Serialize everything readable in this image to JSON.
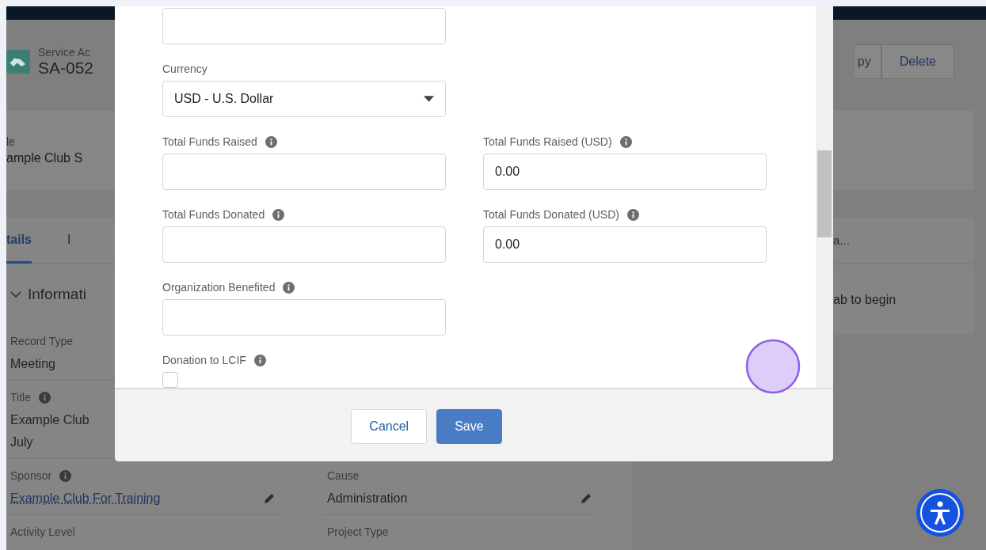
{
  "record": {
    "object_type": "Service Ac",
    "record_name": "SA-052"
  },
  "actions": [
    {
      "label": "py"
    },
    {
      "label": "Delete"
    }
  ],
  "highlight": {
    "label": "le",
    "value": "ample Club S"
  },
  "tabs": [
    {
      "label": "tails",
      "selected": true
    },
    {
      "label": "I",
      "selected": false
    }
  ],
  "section": {
    "title": "Informati",
    "expanded": true
  },
  "details": [
    [
      {
        "label": "Record Type",
        "info": false,
        "kind": "text",
        "lines": [
          "Meeting"
        ],
        "editable": false
      }
    ],
    [
      {
        "label": "Title",
        "info": true,
        "kind": "text",
        "lines": [
          "Example Club",
          "July"
        ],
        "editable": false
      }
    ],
    [
      {
        "label": "Sponsor",
        "info": true,
        "kind": "link",
        "lines": [
          "Example Club For Training"
        ],
        "editable": true
      },
      {
        "label": "Cause",
        "info": false,
        "kind": "text",
        "lines": [
          "Administration"
        ],
        "editable": true
      }
    ],
    [
      {
        "label": "Activity Level",
        "info": false
      },
      {
        "label": "Project Type",
        "info": false
      }
    ]
  ],
  "side_panel": {
    "heading": "a...",
    "message": "ab to begin"
  },
  "modal": {
    "rows": [
      [
        {
          "kind": "text"
        }
      ],
      [
        {
          "kind": "select",
          "label": "Currency",
          "info": false,
          "value": "USD - U.S. Dollar"
        }
      ],
      [
        {
          "kind": "text",
          "label": "Total Funds Raised",
          "info": true
        },
        {
          "kind": "text",
          "label": "Total Funds Raised (USD)",
          "info": true,
          "value": "0.00"
        }
      ],
      [
        {
          "kind": "text",
          "label": "Total Funds Donated",
          "info": true
        },
        {
          "kind": "text",
          "label": "Total Funds Donated (USD)",
          "info": true,
          "value": "0.00"
        }
      ],
      [
        {
          "kind": "text",
          "label": "Organization Benefited",
          "info": true
        }
      ],
      [
        {
          "kind": "checkbox",
          "label": "Donation to LCIF",
          "info": true,
          "checked": false
        }
      ]
    ],
    "buttons": [
      {
        "label": "Cancel",
        "kind": "neutral"
      },
      {
        "label": "Save",
        "kind": "brand"
      }
    ]
  }
}
